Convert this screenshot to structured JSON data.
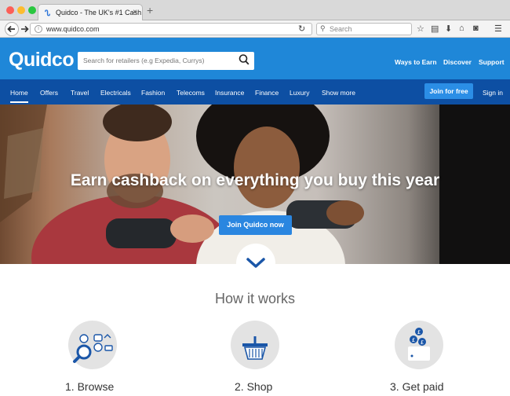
{
  "browser": {
    "tab_title": "Quidco - The UK's #1 Cash...",
    "url": "www.quidco.com",
    "search_placeholder": "Search",
    "new_tab_symbol": "+",
    "tab_close_symbol": "×"
  },
  "header": {
    "logo_text": "Quidco",
    "search_placeholder": "Search for retailers (e.g Expedia, Currys)",
    "links": [
      "Ways to Earn",
      "Discover",
      "Support"
    ]
  },
  "nav": {
    "items": [
      "Home",
      "Offers",
      "Travel",
      "Electricals",
      "Fashion",
      "Telecoms",
      "Insurance",
      "Finance",
      "Luxury",
      "Show more"
    ],
    "active": "Home",
    "join_label": "Join for free",
    "signin_label": "Sign in"
  },
  "hero": {
    "title": "Earn cashback on everything you buy this year",
    "button_label": "Join Quidco now"
  },
  "how_it_works": {
    "title": "How it works",
    "steps": [
      {
        "label": "1. Browse",
        "icon": "browse-icon"
      },
      {
        "label": "2. Shop",
        "icon": "basket-icon"
      },
      {
        "label": "3. Get paid",
        "icon": "coins-icon"
      }
    ]
  },
  "colors": {
    "brand_blue": "#1f87d8",
    "nav_blue": "#0d4fa3",
    "button_blue": "#2b8ee6",
    "step_circle": "#e3e3e3",
    "icon_blue": "#1a56a8"
  }
}
